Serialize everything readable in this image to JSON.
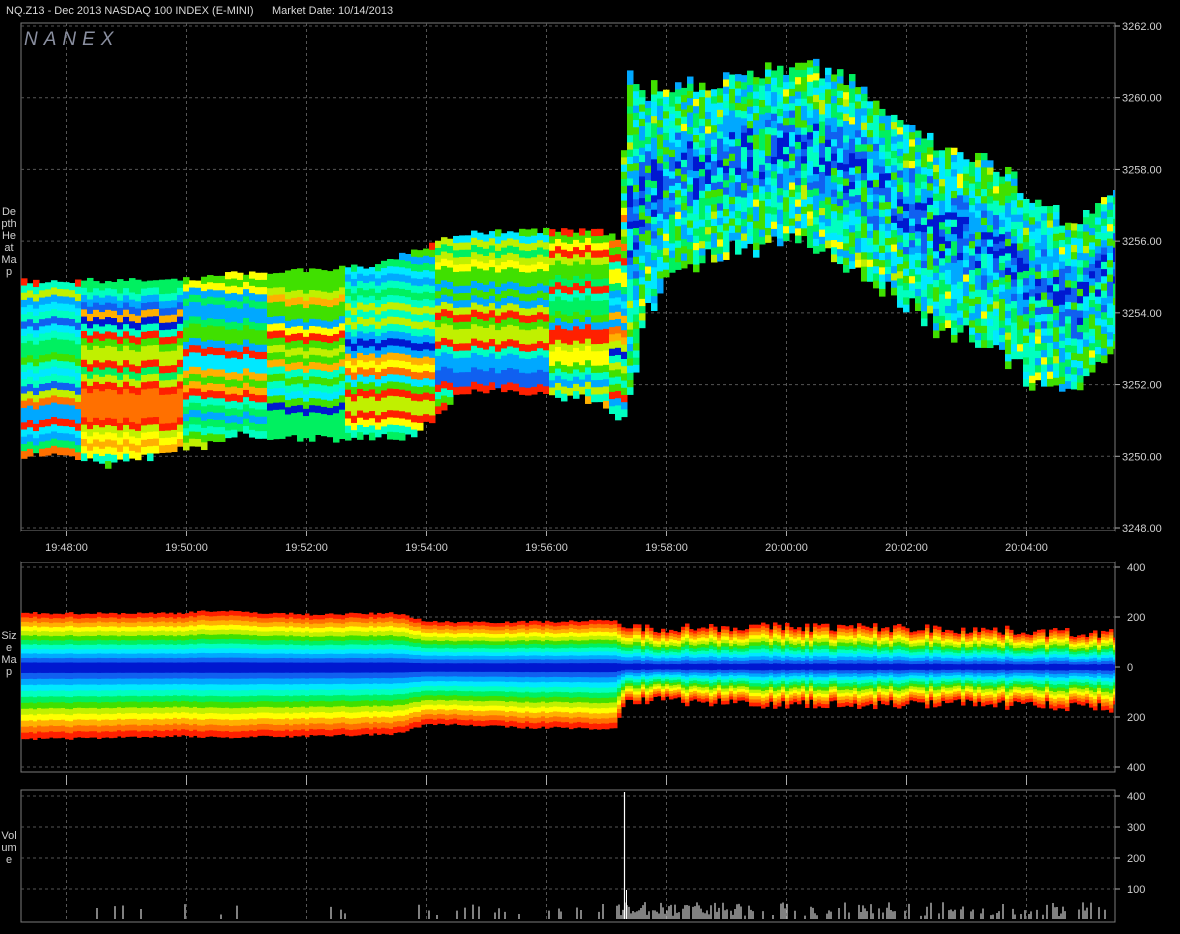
{
  "header": {
    "symbol_title": "NQ.Z13 - Dec 2013 NASDAQ 100 INDEX (E-MINI)",
    "market_date": "Market Date: 10/14/2013",
    "watermark": "NANEX"
  },
  "panels": {
    "depth": {
      "side_label": "Depth Heat Map"
    },
    "size": {
      "side_label": "Size Map"
    },
    "volume": {
      "side_label": "Volume"
    }
  },
  "colors": {
    "background": "#000000",
    "grid": "#555555",
    "axis_text": "#d0d0d0",
    "heat_scale": [
      "#0018d0",
      "#1060f0",
      "#00a8ff",
      "#00e8ff",
      "#00ffc0",
      "#00f060",
      "#40e000",
      "#c0f000",
      "#ffff00",
      "#ffb000",
      "#ff7000",
      "#ff2000"
    ]
  },
  "chart_data": [
    {
      "type": "heatmap",
      "name": "depth-heat-map",
      "title": "Depth Heat Map",
      "x_ticks": [
        "19:48:00",
        "19:50:00",
        "19:52:00",
        "19:54:00",
        "19:56:00",
        "19:58:00",
        "20:00:00",
        "20:02:00",
        "20:04:00"
      ],
      "y_ticks": [
        "3262.00",
        "3260.00",
        "3258.00",
        "3256.00",
        "3254.00",
        "3252.00",
        "3250.00",
        "3248.00"
      ],
      "ylim": [
        3248,
        3262
      ],
      "xlim_minutes": [
        -0.32,
        17.82
      ],
      "grid": true,
      "price_envelope": [
        {
          "t": 0.0,
          "low": 3250.0,
          "high": 3254.9
        },
        {
          "t": 0.7,
          "low": 3249.8,
          "high": 3254.9
        },
        {
          "t": 1.8,
          "low": 3250.1,
          "high": 3254.9
        },
        {
          "t": 2.8,
          "low": 3250.6,
          "high": 3255.1
        },
        {
          "t": 4.0,
          "low": 3250.5,
          "high": 3255.2
        },
        {
          "t": 5.0,
          "low": 3250.5,
          "high": 3255.3
        },
        {
          "t": 5.5,
          "low": 3250.5,
          "high": 3255.6
        },
        {
          "t": 6.0,
          "low": 3250.9,
          "high": 3255.9
        },
        {
          "t": 6.5,
          "low": 3251.8,
          "high": 3256.2
        },
        {
          "t": 7.5,
          "low": 3251.8,
          "high": 3256.3
        },
        {
          "t": 8.8,
          "low": 3251.6,
          "high": 3256.3
        },
        {
          "t": 9.15,
          "low": 3251.0,
          "high": 3256.1
        },
        {
          "t": 9.32,
          "low": 3251.4,
          "high": 3260.6
        },
        {
          "t": 9.6,
          "low": 3253.9,
          "high": 3260.1
        },
        {
          "t": 10.0,
          "low": 3255.2,
          "high": 3260.4
        },
        {
          "t": 10.7,
          "low": 3255.6,
          "high": 3260.4
        },
        {
          "t": 11.5,
          "low": 3255.8,
          "high": 3260.8
        },
        {
          "t": 12.0,
          "low": 3256.2,
          "high": 3260.9
        },
        {
          "t": 12.7,
          "low": 3255.6,
          "high": 3260.8
        },
        {
          "t": 13.3,
          "low": 3255.1,
          "high": 3260.1
        },
        {
          "t": 13.8,
          "low": 3254.4,
          "high": 3259.2
        },
        {
          "t": 14.4,
          "low": 3253.7,
          "high": 3258.7
        },
        {
          "t": 15.0,
          "low": 3253.3,
          "high": 3258.4
        },
        {
          "t": 15.5,
          "low": 3252.8,
          "high": 3258.1
        },
        {
          "t": 16.0,
          "low": 3252.2,
          "high": 3257.2
        },
        {
          "t": 16.4,
          "low": 3251.8,
          "high": 3256.8
        },
        {
          "t": 16.8,
          "low": 3252.0,
          "high": 3256.6
        },
        {
          "t": 17.2,
          "low": 3252.4,
          "high": 3256.9
        },
        {
          "t": 17.6,
          "low": 3253.1,
          "high": 3258.1
        }
      ]
    },
    {
      "type": "area",
      "name": "size-map",
      "title": "Size Map",
      "y_ticks": [
        "400",
        "200",
        "0",
        "200",
        "400"
      ],
      "ylim": [
        -400,
        400
      ],
      "grid": true,
      "envelope": [
        {
          "t": 0.0,
          "top": 215,
          "bottom": -285
        },
        {
          "t": 1.8,
          "top": 215,
          "bottom": -275
        },
        {
          "t": 2.3,
          "top": 225,
          "bottom": -280
        },
        {
          "t": 4.0,
          "top": 210,
          "bottom": -275
        },
        {
          "t": 5.5,
          "top": 215,
          "bottom": -265
        },
        {
          "t": 6.0,
          "top": 180,
          "bottom": -225
        },
        {
          "t": 7.5,
          "top": 180,
          "bottom": -240
        },
        {
          "t": 9.1,
          "top": 185,
          "bottom": -245
        },
        {
          "t": 9.3,
          "top": 155,
          "bottom": -130
        },
        {
          "t": 11.0,
          "top": 160,
          "bottom": -145
        },
        {
          "t": 13.0,
          "top": 160,
          "bottom": -150
        },
        {
          "t": 15.0,
          "top": 150,
          "bottom": -145
        },
        {
          "t": 17.8,
          "top": 130,
          "bottom": -165
        }
      ]
    },
    {
      "type": "bar",
      "name": "volume",
      "title": "Volume",
      "y_ticks": [
        "400",
        "300",
        "200",
        "100"
      ],
      "ylim": [
        0,
        420
      ],
      "grid": true,
      "spike": {
        "t": 9.3,
        "value": 420
      }
    }
  ]
}
